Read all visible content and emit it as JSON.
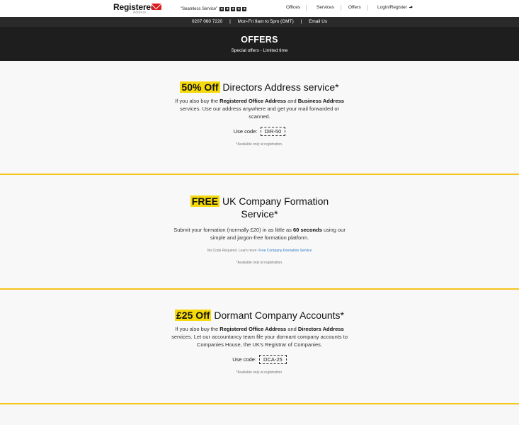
{
  "header": {
    "logo_text": "Registered",
    "logo_sub": "Address",
    "review_text": "\"Seamless Service\"",
    "stars": [
      "★",
      "★",
      "★",
      "★",
      "★"
    ],
    "nav": [
      {
        "label": "Offices"
      },
      {
        "label": "Services"
      },
      {
        "label": "Offers"
      },
      {
        "label": "Login/Register"
      }
    ]
  },
  "contact": {
    "phone": "0207 060 7220",
    "hours": "Mon-Fri  9am to 5pm (GMT)",
    "email": "Email Us",
    "sep": "|"
  },
  "hero": {
    "title": "OFFERS",
    "subtitle": "Special offers - Limited time"
  },
  "offers": [
    {
      "highlight": "50% Off",
      "title_rest": " Directors Address service*",
      "body": {
        "p1": "If you also buy the ",
        "b1": "Registered Office Address",
        "p2": " and ",
        "b2": "Business Address",
        "p3": " services. Use our address anywhere and get your mail forwarded or scanned."
      },
      "code_label": "Use code:",
      "code": "DIR-50",
      "fine": "*Available only at registration."
    },
    {
      "highlight": "FREE",
      "title_rest": " UK Company Formation Service*",
      "body": {
        "p1": "Submit your formation (normally £20) in as little as ",
        "b1": "60 seconds",
        "p2": " using our simple and jargon-free formation platform."
      },
      "note_prefix": "No Code Required. Learn more: ",
      "note_link": "Free Company Formation Service",
      "fine": "*Available only at registration."
    },
    {
      "highlight": "£25 Off",
      "title_rest": " Dormant Company Accounts*",
      "body": {
        "p1": "If you also buy the ",
        "b1": "Registered Office Address",
        "p2": " and ",
        "b2": "Directors Address",
        "p3": " services. Let our accountancy team file your dormant company accounts to Companies House, the UK's Registrar of Companies."
      },
      "code_label": "Use code:",
      "code": "DCA-25",
      "fine": "*Available only at registration."
    }
  ],
  "colors": {
    "accent": "#f5d90a",
    "divider": "#f5c71a",
    "dark": "#1e1e1e",
    "link": "#2a79c4"
  }
}
